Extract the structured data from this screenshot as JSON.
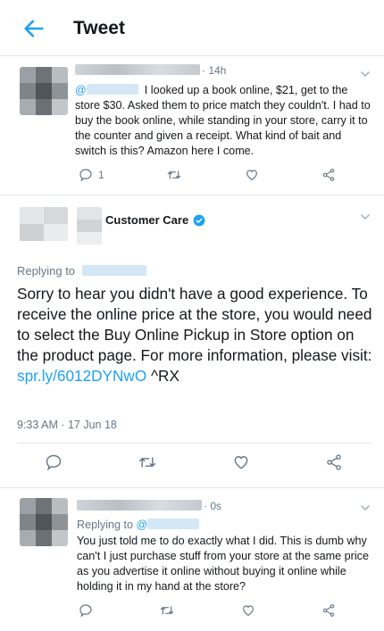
{
  "header": {
    "title": "Tweet"
  },
  "tweet1": {
    "time": "· 14h",
    "mention_prefix": "@",
    "text": "I looked up a book online, $21, get to the store $30. Asked them to price match they couldn't. I had to buy the book online, while standing in your store, carry it to the counter and given a receipt. What kind of bait and switch is this? Amazon here I come.",
    "reply_count": "1"
  },
  "main_tweet": {
    "display_name": "Customer Care",
    "replying_to_label": "Replying to",
    "text_before_link": "Sorry to hear you didn't have a good experience. To receive the online price at the store, you would need to select the Buy Online Pickup in Store option on the product page. For more information, please visit: ",
    "link_text": "spr.ly/6012DYNwO",
    "text_after_link": " ^RX",
    "timestamp": "9:33 AM · 17 Jun 18"
  },
  "tweet3": {
    "time": "· 0s",
    "replying_to_label": "Replying to",
    "mention_prefix": "@",
    "text": "You just told me to do exactly what I did. This is dumb why can't I just purchase stuff from your store at the same price as you advertise it online without buying it online while holding it in my hand at the store?"
  },
  "icons": [
    "back-arrow-icon",
    "reply-icon",
    "retweet-icon",
    "like-icon",
    "share-icon",
    "chevron-down-icon",
    "verified-badge-icon"
  ],
  "colors": {
    "accent": "#1da1f2",
    "secondary_text": "#657786",
    "divider": "#e1e8ed"
  }
}
